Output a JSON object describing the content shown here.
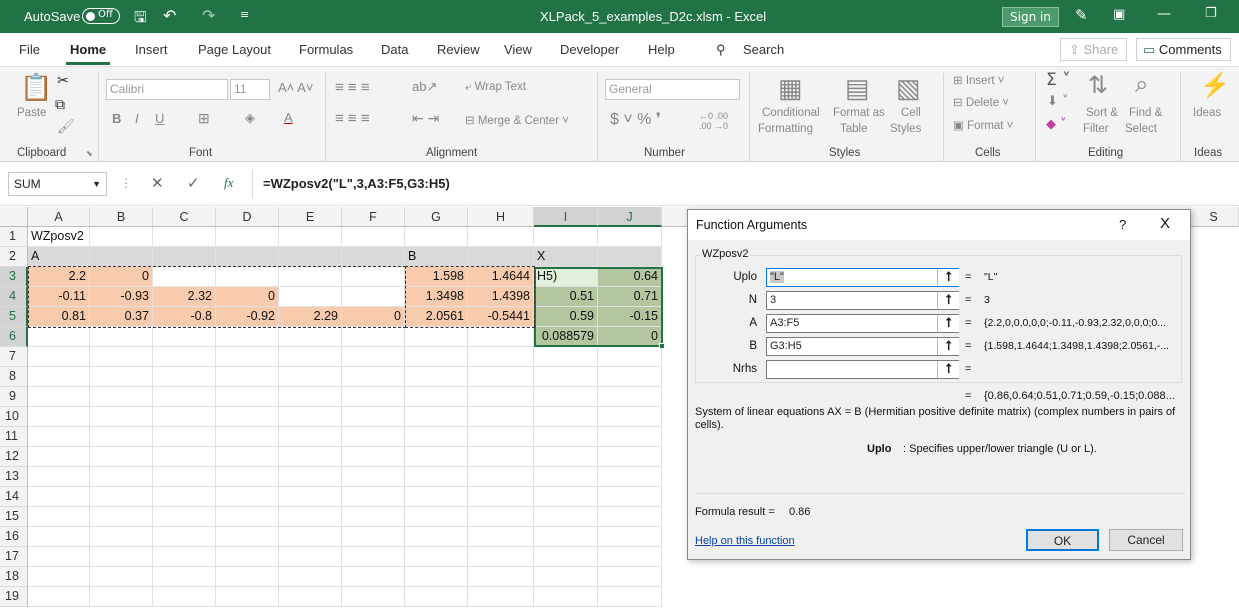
{
  "titlebar": {
    "autosave_label": "AutoSave",
    "autosave_state": "Off",
    "filename": "XLPack_5_examples_D2c.xlsm  -  Excel",
    "signin": "Sign in"
  },
  "menu": {
    "items": [
      "File",
      "Home",
      "Insert",
      "Page Layout",
      "Formulas",
      "Data",
      "Review",
      "View",
      "Developer",
      "Help"
    ],
    "search": "Search",
    "share": "Share",
    "comments": "Comments"
  },
  "ribbon": {
    "clipboard": {
      "label": "Clipboard",
      "paste": "Paste"
    },
    "font": {
      "label": "Font",
      "name": "Calibri",
      "size": "11"
    },
    "alignment": {
      "label": "Alignment",
      "wrap": "Wrap Text",
      "merge": "Merge & Center"
    },
    "number": {
      "label": "Number",
      "format": "General"
    },
    "styles": {
      "label": "Styles",
      "cond1": "Conditional",
      "cond2": "Formatting",
      "fmt1": "Format as",
      "fmt2": "Table",
      "cell1": "Cell",
      "cell2": "Styles"
    },
    "cells": {
      "label": "Cells",
      "insert": "Insert",
      "delete": "Delete",
      "format": "Format"
    },
    "editing": {
      "label": "Editing",
      "sort1": "Sort &",
      "sort2": "Filter",
      "find1": "Find &",
      "find2": "Select"
    },
    "ideas": {
      "label": "Ideas",
      "btn": "Ideas"
    }
  },
  "formula_bar": {
    "name_box": "SUM",
    "formula": "=WZposv2(\"L\",3,A3:F5,G3:H5)"
  },
  "columns": [
    "A",
    "B",
    "C",
    "D",
    "E",
    "F",
    "G",
    "H",
    "I",
    "J",
    "S"
  ],
  "rows": [
    "1",
    "2",
    "3",
    "4",
    "5",
    "6",
    "7",
    "8",
    "9",
    "10",
    "11",
    "12",
    "13",
    "14",
    "15",
    "16",
    "17",
    "18",
    "19"
  ],
  "cells": {
    "A1": "WZposv2",
    "A2": "A",
    "G2": "B",
    "I2": "X",
    "A3": "2.2",
    "B3": "0",
    "G3": "1.598",
    "H3": "1.4644",
    "I3": "H5)",
    "J3": "0.64",
    "A4": "-0.11",
    "B4": "-0.93",
    "C4": "2.32",
    "D4": "0",
    "G4": "1.3498",
    "H4": "1.4398",
    "I4": "0.51",
    "J4": "0.71",
    "A5": "0.81",
    "B5": "0.37",
    "C5": "-0.8",
    "D5": "-0.92",
    "E5": "2.29",
    "F5": "0",
    "G5": "2.0561",
    "H5": "-0.5441",
    "I5": "0.59",
    "J5": "-0.15",
    "I6": "0.088579",
    "J6": "0"
  },
  "dialog": {
    "title": "Function Arguments",
    "help_mark": "?",
    "close": "X",
    "function_name": "WZposv2",
    "args": [
      {
        "name": "Uplo",
        "value": "\"L\"",
        "result": "\"L\""
      },
      {
        "name": "N",
        "value": "3",
        "result": "3"
      },
      {
        "name": "A",
        "value": "A3:F5",
        "result": "{2.2,0,0,0,0,0;-0.11,-0.93,2.32,0,0,0;0..."
      },
      {
        "name": "B",
        "value": "G3:H5",
        "result": "{1.598,1.4644;1.3498,1.4398;2.0561,-..."
      },
      {
        "name": "Nrhs",
        "value": "",
        "result": ""
      }
    ],
    "equals": "=",
    "total_result": "{0.86,0.64;0.51,0.71;0.59,-0.15;0.088...",
    "description": "System of linear equations AX = B (Hermitian positive definite matrix) (complex numbers in pairs of cells).",
    "arg_help_name": "Uplo",
    "arg_help_text": ": Specifies upper/lower triangle (U or L).",
    "formula_result_label": "Formula result =",
    "formula_result_value": "0.86",
    "help_link": "Help on this function",
    "ok": "OK",
    "cancel": "Cancel"
  }
}
